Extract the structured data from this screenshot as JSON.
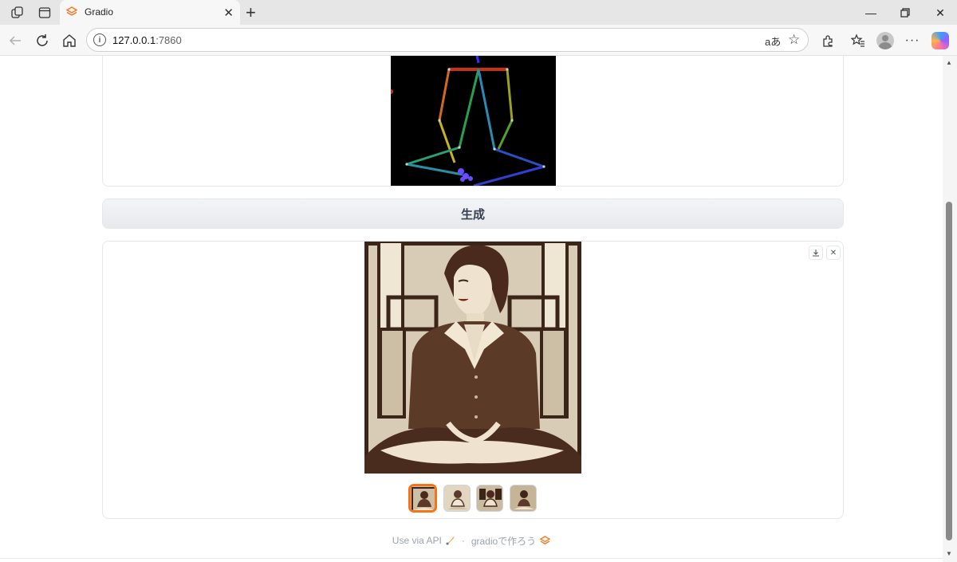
{
  "browser": {
    "tab_title": "Gradio",
    "url_host": "127.0.0.1",
    "url_port": ":7860",
    "icons": [
      "workspaces-icon",
      "tab-actions-icon",
      "back-icon",
      "refresh-icon",
      "home-icon",
      "info-icon",
      "read-aloud-icon",
      "favorite-icon",
      "extensions-icon",
      "favorites-icon",
      "profile-icon",
      "menu-icon",
      "copilot-icon"
    ]
  },
  "app": {
    "generate_button": "生成",
    "gallery": {
      "selected_index": 0,
      "thumbnail_count": 4,
      "download_icon": "download-icon",
      "close_icon": "close-icon"
    },
    "footer": {
      "api_link": "Use via API",
      "separator": "·",
      "built_with": "gradioで作ろう"
    }
  },
  "colors": {
    "accent": "#f97316",
    "button_bg": "#eceef1",
    "pose_bg": "#000000",
    "sepia_dark": "#5a3a28",
    "sepia_light": "#e8dcc6"
  }
}
